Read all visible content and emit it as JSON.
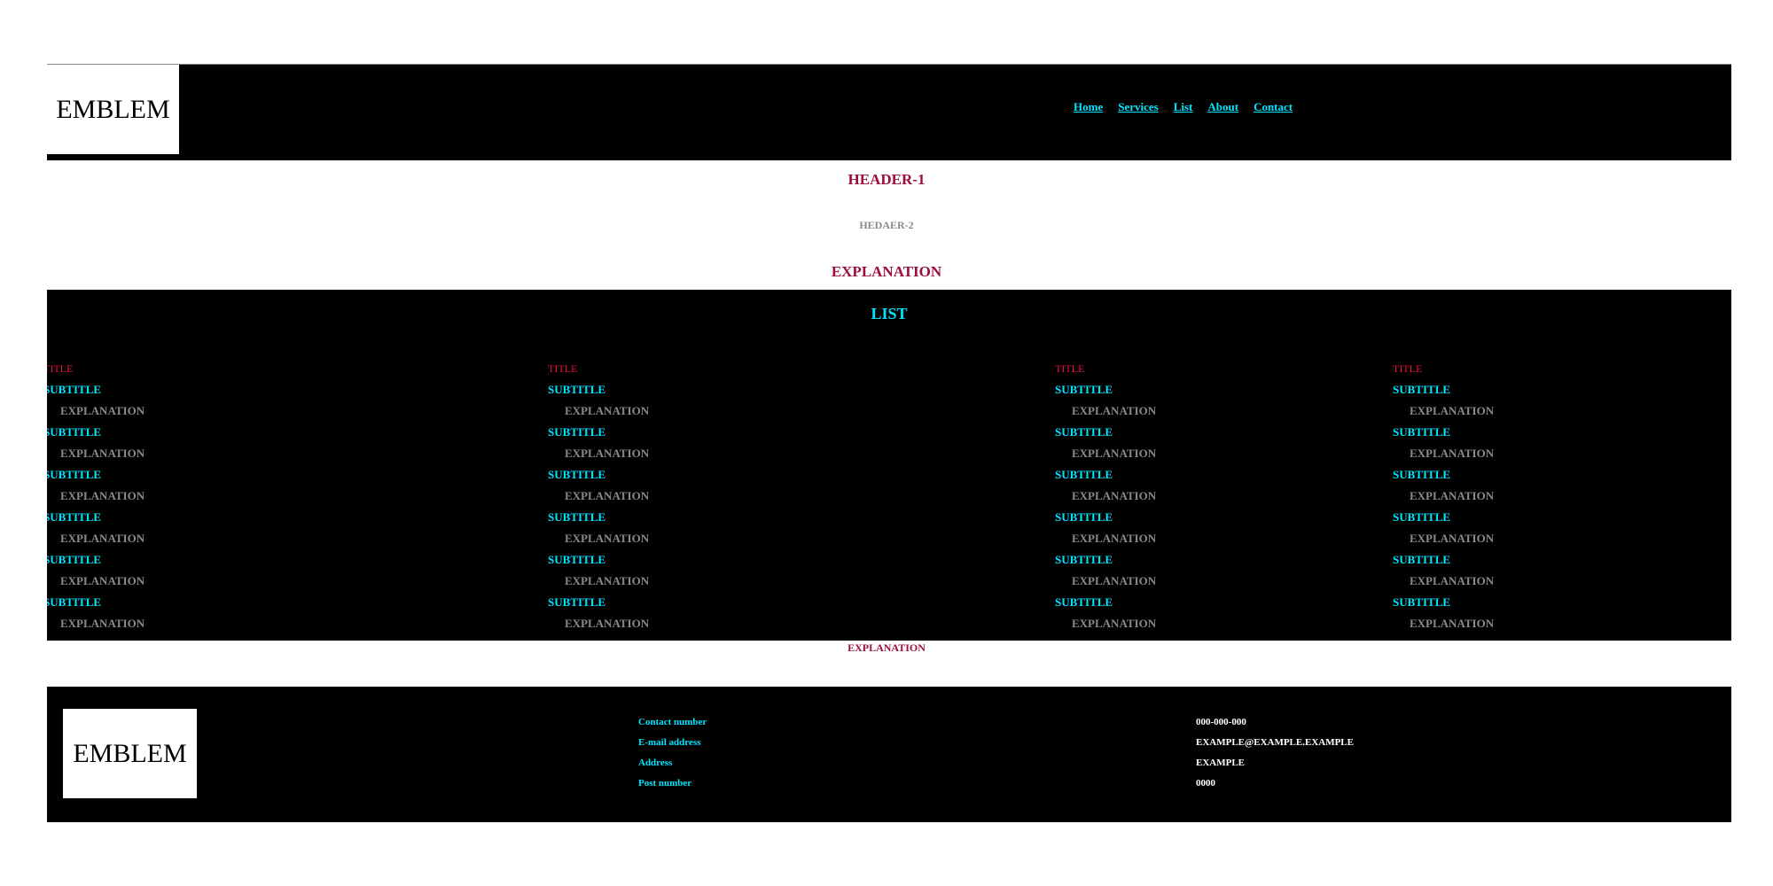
{
  "header": {
    "emblem": "EMBLEM",
    "nav": [
      "Home",
      "Services",
      "List",
      "About",
      "Contact"
    ]
  },
  "main": {
    "header1": "HEADER-1",
    "header2": "HEDAER-2",
    "explanation_top": "EXPLANATION",
    "list_heading": "LIST",
    "columns": [
      {
        "title": "TITLE",
        "items": [
          {
            "subtitle": "SUBTITLE",
            "explanation": "EXPLANATION"
          },
          {
            "subtitle": "SUBTITLE",
            "explanation": "EXPLANATION"
          },
          {
            "subtitle": "SUBTITLE",
            "explanation": "EXPLANATION"
          },
          {
            "subtitle": "SUBTITLE",
            "explanation": "EXPLANATION"
          },
          {
            "subtitle": "SUBTITLE",
            "explanation": "EXPLANATION"
          },
          {
            "subtitle": "SUBTITLE",
            "explanation": "EXPLANATION"
          }
        ]
      },
      {
        "title": "TITLE",
        "items": [
          {
            "subtitle": "SUBTITLE",
            "explanation": "EXPLANATION"
          },
          {
            "subtitle": "SUBTITLE",
            "explanation": "EXPLANATION"
          },
          {
            "subtitle": "SUBTITLE",
            "explanation": "EXPLANATION"
          },
          {
            "subtitle": "SUBTITLE",
            "explanation": "EXPLANATION"
          },
          {
            "subtitle": "SUBTITLE",
            "explanation": "EXPLANATION"
          },
          {
            "subtitle": "SUBTITLE",
            "explanation": "EXPLANATION"
          }
        ]
      },
      {
        "title": "TITLE",
        "items": [
          {
            "subtitle": "SUBTITLE",
            "explanation": "EXPLANATION"
          },
          {
            "subtitle": "SUBTITLE",
            "explanation": "EXPLANATION"
          },
          {
            "subtitle": "SUBTITLE",
            "explanation": "EXPLANATION"
          },
          {
            "subtitle": "SUBTITLE",
            "explanation": "EXPLANATION"
          },
          {
            "subtitle": "SUBTITLE",
            "explanation": "EXPLANATION"
          },
          {
            "subtitle": "SUBTITLE",
            "explanation": "EXPLANATION"
          }
        ]
      },
      {
        "title": "TITLE",
        "items": [
          {
            "subtitle": "SUBTITLE",
            "explanation": "EXPLANATION"
          },
          {
            "subtitle": "SUBTITLE",
            "explanation": "EXPLANATION"
          },
          {
            "subtitle": "SUBTITLE",
            "explanation": "EXPLANATION"
          },
          {
            "subtitle": "SUBTITLE",
            "explanation": "EXPLANATION"
          },
          {
            "subtitle": "SUBTITLE",
            "explanation": "EXPLANATION"
          },
          {
            "subtitle": "SUBTITLE",
            "explanation": "EXPLANATION"
          }
        ]
      }
    ],
    "explanation_bottom": "EXPLANATION"
  },
  "footer": {
    "emblem": "EMBLEM",
    "labels": [
      "Contact number",
      "E-mail address",
      "Address",
      "Post number"
    ],
    "values": [
      "000-000-000",
      "EXAMPLE@EXAMPLE.EXAMPLE",
      "EXAMPLE",
      "0000"
    ]
  },
  "colors": {
    "accent_cyan": "#00e5ff",
    "title_red": "#e8103c",
    "heading_crimson": "#9c0d3a",
    "muted_gray": "#8a8a8a"
  }
}
